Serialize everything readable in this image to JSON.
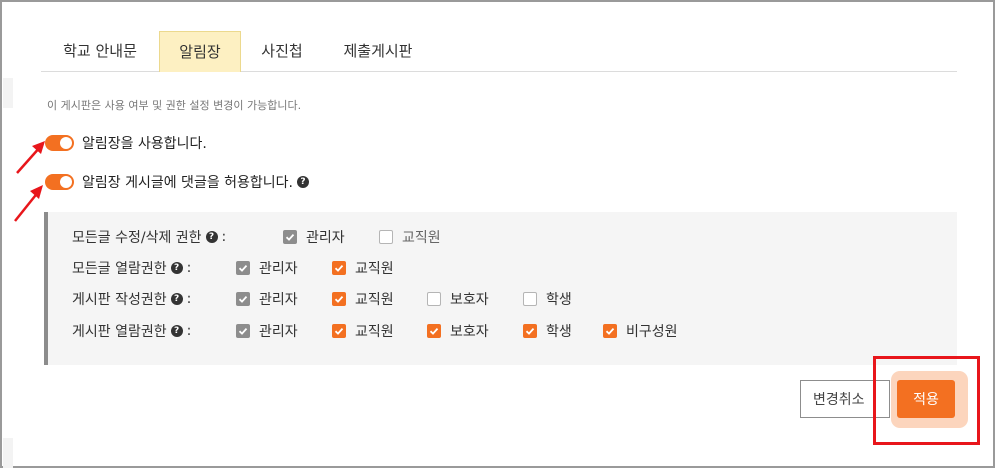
{
  "tabs": [
    {
      "label": "학교 안내문",
      "active": false
    },
    {
      "label": "알림장",
      "active": true
    },
    {
      "label": "사진첩",
      "active": false
    },
    {
      "label": "제출게시판",
      "active": false
    }
  ],
  "description": "이 게시판은 사용 여부 및 권한 설정 변경이 가능합니다.",
  "toggles": [
    {
      "label": "알림장을 사용합니다.",
      "on": true,
      "help": false
    },
    {
      "label": "알림장 게시글에 댓글을 허용합니다.",
      "on": true,
      "help": true
    }
  ],
  "permissions": {
    "colon": ":",
    "rows": [
      {
        "label": "모든글 수정/삭제 권한",
        "options": [
          {
            "label": "관리자",
            "state": "locked"
          },
          {
            "label": "교직원",
            "state": "unchecked"
          }
        ]
      },
      {
        "label": "모든글 열람권한",
        "options": [
          {
            "label": "관리자",
            "state": "locked"
          },
          {
            "label": "교직원",
            "state": "checked"
          }
        ]
      },
      {
        "label": "게시판 작성권한",
        "options": [
          {
            "label": "관리자",
            "state": "locked"
          },
          {
            "label": "교직원",
            "state": "checked"
          },
          {
            "label": "보호자",
            "state": "unchecked"
          },
          {
            "label": "학생",
            "state": "unchecked"
          }
        ]
      },
      {
        "label": "게시판 열람권한",
        "options": [
          {
            "label": "관리자",
            "state": "locked"
          },
          {
            "label": "교직원",
            "state": "checked"
          },
          {
            "label": "보호자",
            "state": "checked"
          },
          {
            "label": "학생",
            "state": "checked"
          },
          {
            "label": "비구성원",
            "state": "checked"
          }
        ]
      }
    ]
  },
  "buttons": {
    "cancel": "변경취소",
    "apply": "적용"
  },
  "help_icon_glyph": "?",
  "colors": {
    "accent": "#f37021",
    "tab_active_bg": "#fdf0c2",
    "annotation_red": "#e8161b"
  }
}
